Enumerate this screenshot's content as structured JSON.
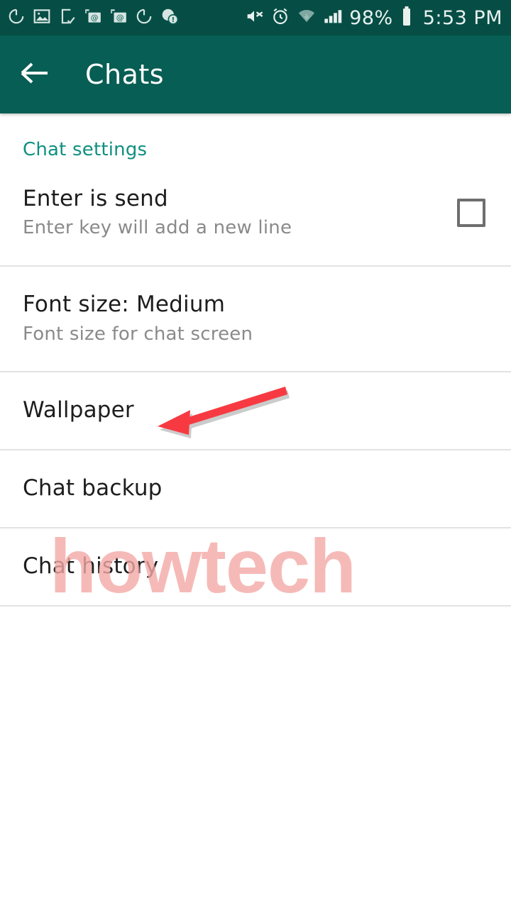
{
  "status_bar": {
    "left_icons": [
      {
        "name": "sync-icon"
      },
      {
        "name": "image-icon"
      },
      {
        "name": "file-download-icon"
      },
      {
        "name": "email-screenshot-icon"
      },
      {
        "name": "email-screenshot-icon-2"
      },
      {
        "name": "sync-icon-2"
      },
      {
        "name": "info-badge-icon"
      }
    ],
    "right_icons": [
      {
        "name": "mute-icon"
      },
      {
        "name": "alarm-icon"
      },
      {
        "name": "wifi-icon"
      },
      {
        "name": "signal-icon"
      },
      {
        "name": "battery-icon"
      }
    ],
    "battery_percent": "98%",
    "time": "5:53 PM"
  },
  "app_bar": {
    "back_icon": "back-arrow-icon",
    "title": "Chats"
  },
  "section": {
    "header": "Chat settings"
  },
  "rows": [
    {
      "title": "Enter is send",
      "subtitle": "Enter key will add a new line",
      "has_checkbox": true,
      "checked": false
    },
    {
      "title": "Font size: Medium",
      "subtitle": "Font size for chat screen",
      "has_checkbox": false
    },
    {
      "title": "Wallpaper",
      "subtitle": "",
      "has_checkbox": false
    },
    {
      "title": "Chat backup",
      "subtitle": "",
      "has_checkbox": false
    },
    {
      "title": "Chat history",
      "subtitle": "",
      "has_checkbox": false
    }
  ],
  "annotation": {
    "arrow_color": "#f73a42",
    "points_to": "Wallpaper"
  },
  "watermark": {
    "text": "howtech",
    "color": "#f3a9a6"
  },
  "colors": {
    "status_bar": "#064E45",
    "app_bar": "#075E54",
    "accent_teal": "#0F9081",
    "divider": "#e2e2e2"
  }
}
